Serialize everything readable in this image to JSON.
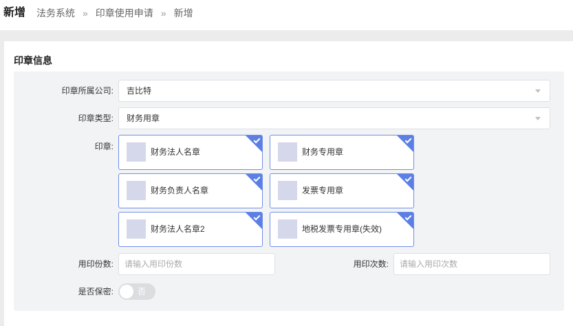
{
  "header": {
    "title": "新增",
    "breadcrumb": [
      "法务系统",
      "印章使用申请",
      "新增"
    ],
    "separator": "»"
  },
  "section": {
    "title": "印章信息"
  },
  "form": {
    "company": {
      "label": "印章所属公司:",
      "value": "吉比特",
      "icon": "chevron-down-icon"
    },
    "seal_type": {
      "label": "印章类型:",
      "value": "财务用章",
      "icon": "chevron-down-icon"
    },
    "seals": {
      "label": "印章:",
      "items": [
        {
          "name": "财务法人名章",
          "selected": true
        },
        {
          "name": "财务专用章",
          "selected": true
        },
        {
          "name": "财务负责人名章",
          "selected": true
        },
        {
          "name": "发票专用章",
          "selected": true
        },
        {
          "name": "财务法人名章2",
          "selected": true
        },
        {
          "name": "地税发票专用章(失效)",
          "selected": true
        }
      ]
    },
    "copies": {
      "label": "用印份数:",
      "placeholder": "请输入用印份数"
    },
    "times": {
      "label": "用印次数:",
      "placeholder": "请输入用印次数"
    },
    "confidential": {
      "label": "是否保密:",
      "state_text": "否",
      "on": false
    }
  },
  "colors": {
    "accent": "#5b7fe4",
    "card_border": "#6f8ee8",
    "form_bg": "#f2f3f5",
    "thumbnail": "#d5d8eb",
    "toggle_off": "#dcdde0"
  }
}
